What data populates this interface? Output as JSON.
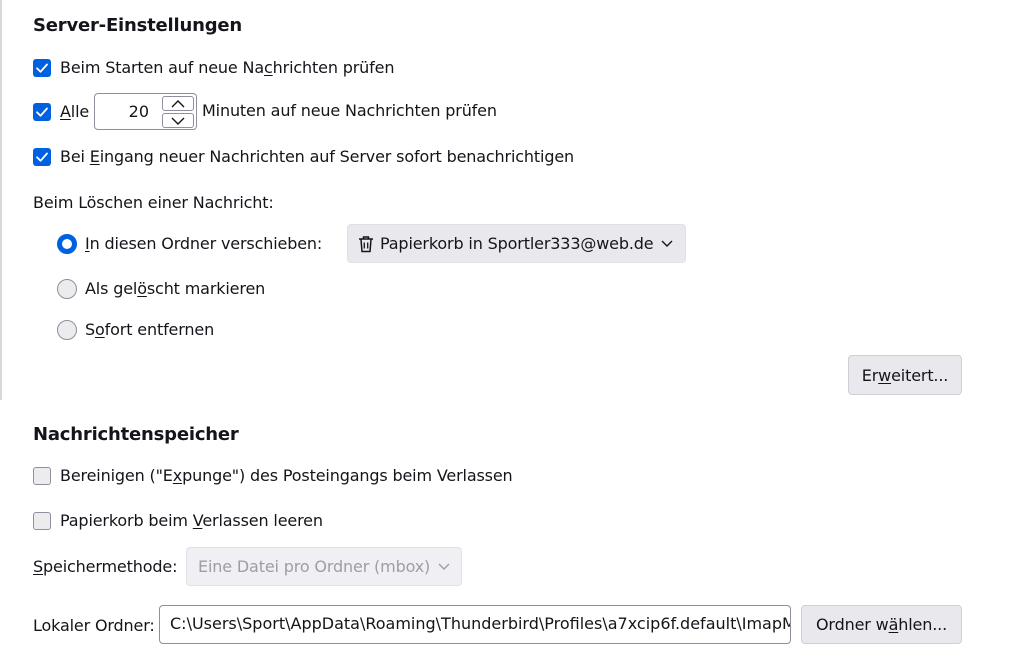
{
  "server_settings": {
    "heading": "Server-Einstellungen",
    "check_on_start": {
      "checked": true,
      "pre": "Beim Starten auf neue Na",
      "key": "c",
      "post": "hrichten prüfen"
    },
    "check_every": {
      "checked": true,
      "key": "A",
      "post": "lle",
      "minutes_value": "20",
      "suffix": "Minuten auf neue Nachrichten prüfen"
    },
    "notify_server": {
      "checked": true,
      "pre": "Bei ",
      "key": "E",
      "post": "ingang neuer Nachrichten auf Server sofort benachrichtigen"
    }
  },
  "delete_message": {
    "label": "Beim Löschen einer Nachricht:",
    "move_to_folder": {
      "selected": true,
      "key": "I",
      "post": "n diesen Ordner verschieben:"
    },
    "folder_select": {
      "icon": "trash-icon",
      "value": "Papierkorb in Sportler333@web.de"
    },
    "mark_deleted": {
      "selected": false,
      "pre": "Als gel",
      "key": "ö",
      "post": "scht markieren"
    },
    "remove_now": {
      "selected": false,
      "pre": "S",
      "key": "o",
      "post": "fort entfernen"
    },
    "advanced_button": {
      "pre": "Er",
      "key": "w",
      "post": "eitert..."
    }
  },
  "message_store": {
    "heading": "Nachrichtenspeicher",
    "expunge": {
      "checked": false,
      "pre": "Bereinigen (\"E",
      "key": "x",
      "post": "punge\") des Posteingangs beim Verlassen"
    },
    "empty_trash": {
      "checked": false,
      "pre": "Papierkorb beim ",
      "key": "V",
      "post": "erlassen leeren"
    },
    "storage_method": {
      "key": "S",
      "post": "peichermethode:",
      "value": "Eine Datei pro Ordner (mbox)"
    },
    "local_folder": {
      "label": "Lokaler Ordner:",
      "value": "C:\\Users\\Sport\\AppData\\Roaming\\Thunderbird\\Profiles\\a7xcip6f.default\\ImapMail\\imap.web.de"
    },
    "choose_folder_button": {
      "pre": "Ordner w",
      "key": "ä",
      "post": "hlen..."
    }
  },
  "colors": {
    "accent": "#0061e0",
    "button_bg": "#e9e9ed",
    "text": "#15141a",
    "disabled_text": "#9d9da3"
  }
}
